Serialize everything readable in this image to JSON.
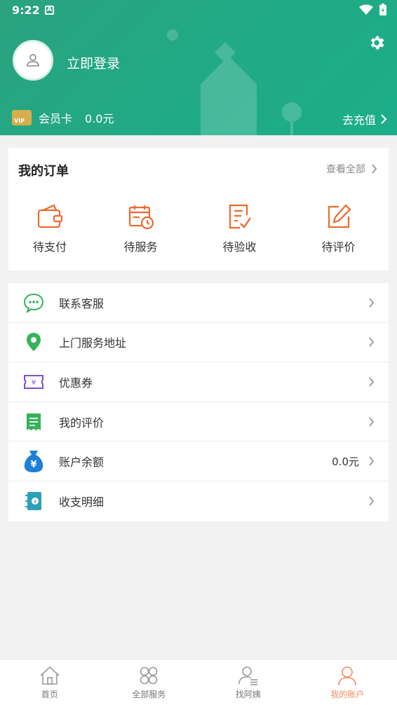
{
  "status": {
    "time": "9:22",
    "a_badge": "A"
  },
  "header": {
    "login_text": "立即登录",
    "vip_badge": "VIP",
    "vip_label": "会员卡",
    "vip_value": "0.0元",
    "recharge_label": "去充值"
  },
  "orders": {
    "title": "我的订单",
    "view_all": "查看全部",
    "items": [
      {
        "label": "待支付",
        "icon": "wallet-icon"
      },
      {
        "label": "待服务",
        "icon": "calendar-clock-icon"
      },
      {
        "label": "待验收",
        "icon": "checklist-icon"
      },
      {
        "label": "待评价",
        "icon": "edit-icon"
      }
    ]
  },
  "menu": {
    "items": [
      {
        "label": "联系客服",
        "icon": "chat-icon",
        "value": ""
      },
      {
        "label": "上门服务地址",
        "icon": "location-pin-icon",
        "value": ""
      },
      {
        "label": "优惠券",
        "icon": "coupon-icon",
        "value": ""
      },
      {
        "label": "我的评价",
        "icon": "review-icon",
        "value": ""
      },
      {
        "label": "账户余额",
        "icon": "money-bag-icon",
        "value": "0.0元"
      },
      {
        "label": "收支明细",
        "icon": "ledger-icon",
        "value": ""
      }
    ]
  },
  "nav": {
    "items": [
      {
        "label": "首页",
        "icon": "home-icon"
      },
      {
        "label": "全部服务",
        "icon": "grid-icon"
      },
      {
        "label": "找阿姨",
        "icon": "person-list-icon"
      },
      {
        "label": "我的账户",
        "icon": "person-icon"
      }
    ],
    "active_index": 3
  },
  "colors": {
    "header_green": "#23a884",
    "accent_orange": "#f08a5d",
    "vip_gold": "#d8ae4c"
  }
}
